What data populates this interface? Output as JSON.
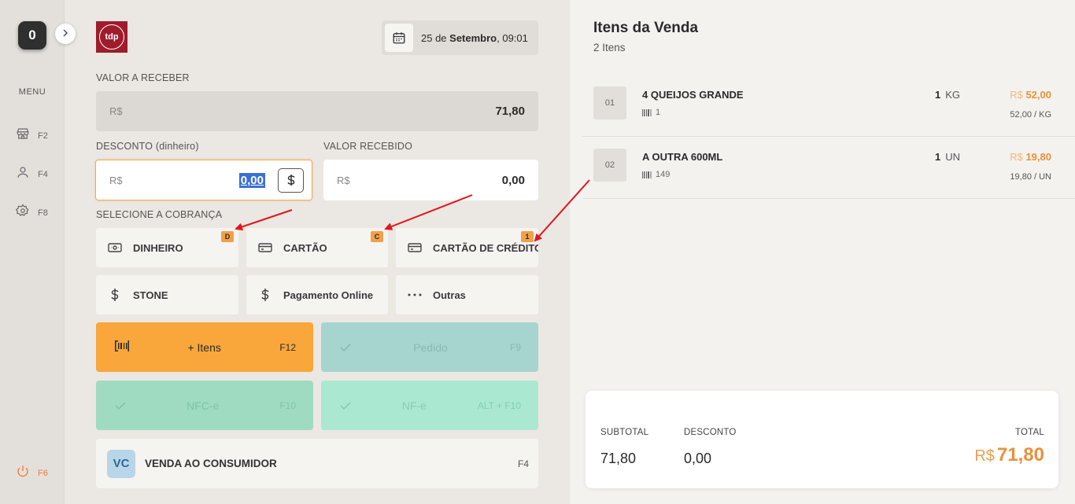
{
  "sidebar": {
    "counter": "0",
    "menu_label": "MENU",
    "items": [
      {
        "icon": "store-icon",
        "key": "F2"
      },
      {
        "icon": "user-icon",
        "key": "F4"
      },
      {
        "icon": "gear-icon",
        "key": "F8"
      },
      {
        "icon": "power-icon",
        "key": "F6"
      }
    ]
  },
  "header": {
    "logo_text": "tdp",
    "date_day": "25 de ",
    "date_month": "Setembro",
    "date_time": ", 09:01"
  },
  "valor_receber": {
    "label": "VALOR A RECEBER",
    "currency": "R$",
    "value": "71,80"
  },
  "desconto": {
    "label": "DESCONTO (dinheiro)",
    "currency": "R$",
    "value": "0,00"
  },
  "valor_recebido": {
    "label": "VALOR RECEBIDO",
    "currency": "R$",
    "value": "0,00"
  },
  "cobranca": {
    "label": "SELECIONE A COBRANÇA",
    "options": [
      {
        "label": "DINHEIRO",
        "badge": "D",
        "icon": "cash-icon"
      },
      {
        "label": "CARTÃO",
        "badge": "C",
        "icon": "card-icon"
      },
      {
        "label": "CARTÃO DE CRÉDITO",
        "badge": "1",
        "icon": "card-icon"
      },
      {
        "label": "STONE",
        "icon": "dollar-icon"
      },
      {
        "label": "Pagamento Online",
        "icon": "dollar-icon"
      },
      {
        "label": "Outras",
        "icon": "dots-icon"
      }
    ]
  },
  "actions": {
    "itens": {
      "label": "+ Itens",
      "key": "F12"
    },
    "pedido": {
      "label": "Pedido",
      "key": "F9"
    },
    "nfce": {
      "label": "NFC-e",
      "key": "F10"
    },
    "nfe": {
      "label": "NF-e",
      "key": "ALT + F10"
    }
  },
  "consumer": {
    "initials": "VC",
    "name": "VENDA AO CONSUMIDOR",
    "key": "F4"
  },
  "sale": {
    "title": "Itens da Venda",
    "subtitle": "2 Itens",
    "items": [
      {
        "num": "01",
        "name": "4 QUEIJOS GRANDE",
        "code": "1",
        "qty": "1",
        "unit": "KG",
        "currency": "R$",
        "price": "52,00",
        "unit_price": "52,00 / KG"
      },
      {
        "num": "02",
        "name": "A OUTRA 600ML",
        "code": "149",
        "qty": "1",
        "unit": "UN",
        "currency": "R$",
        "price": "19,80",
        "unit_price": "19,80 / UN"
      }
    ]
  },
  "totals": {
    "subtotal_label": "SUBTOTAL",
    "subtotal": "71,80",
    "desconto_label": "DESCONTO",
    "desconto": "0,00",
    "total_label": "TOTAL",
    "total_currency": "R$",
    "total": "71,80"
  },
  "colors": {
    "accent": "#f9a63b",
    "price": "#e8913a",
    "annotation_arrow": "#e0161b"
  }
}
